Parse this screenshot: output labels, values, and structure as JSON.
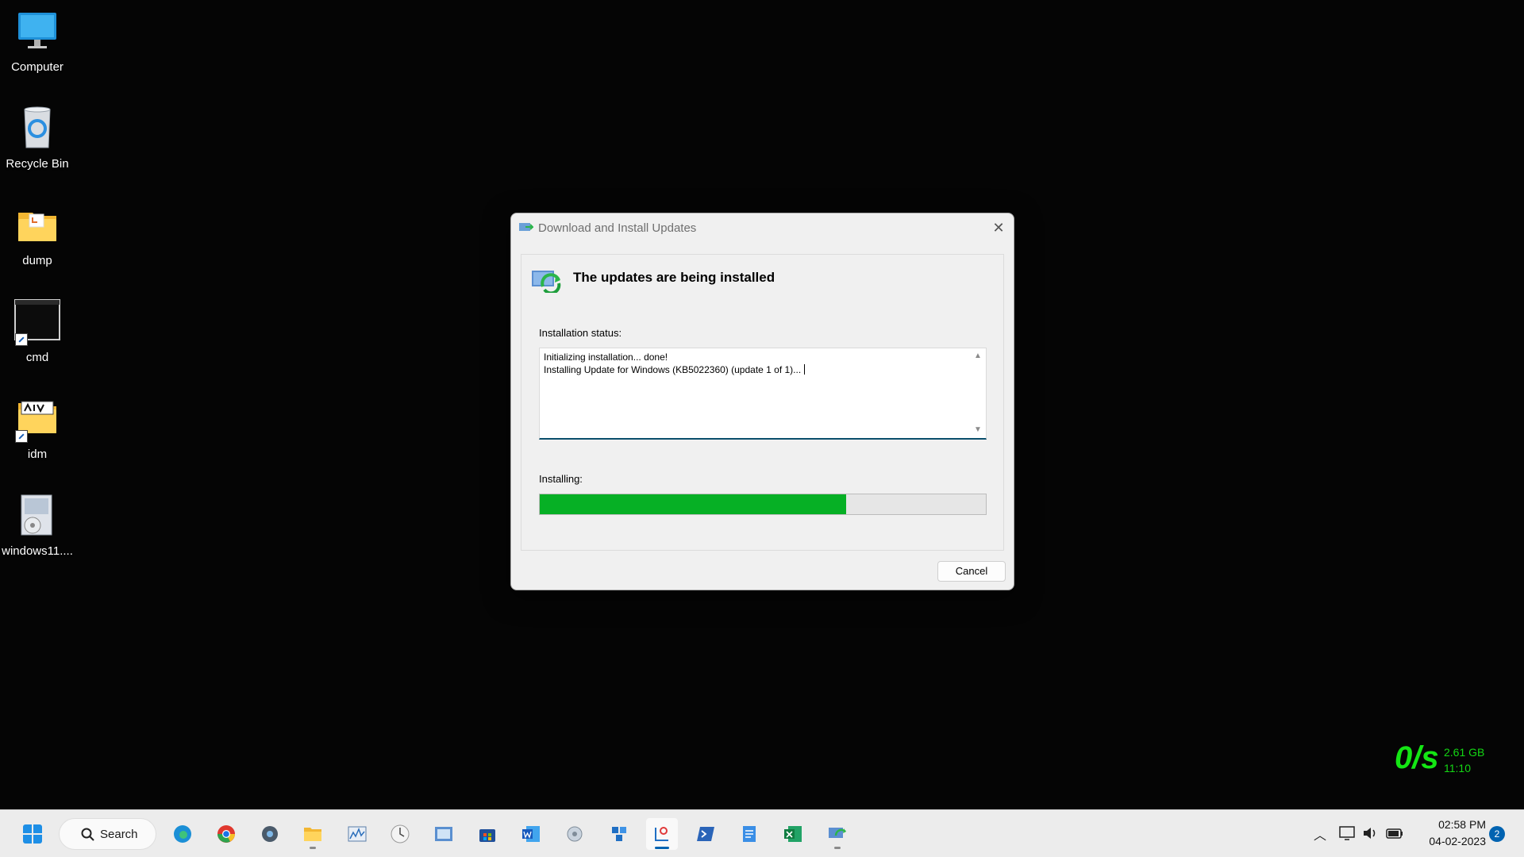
{
  "desktop": {
    "icons": [
      {
        "label": "Computer",
        "icon": "monitor-icon"
      },
      {
        "label": "Recycle Bin",
        "icon": "recycle-bin-icon"
      },
      {
        "label": "dump",
        "icon": "folder-icon"
      },
      {
        "label": "cmd",
        "icon": "terminal-icon"
      },
      {
        "label": "idm",
        "icon": "folder-icon"
      },
      {
        "label": "windows11....",
        "icon": "installer-icon"
      }
    ]
  },
  "dialog": {
    "title": "Download and Install Updates",
    "close_glyph": "✕",
    "heading": "The updates are being installed",
    "status_label": "Installation status:",
    "log_lines": [
      "Initializing installation... done!",
      "Installing Update for Windows (KB5022360) (update 1 of 1)..."
    ],
    "progress_label": "Installing:",
    "progress_fraction": 0.687,
    "cancel_label": "Cancel",
    "accent_color": "#06b025"
  },
  "netmeter": {
    "speed": "0/s",
    "data_used": "2.61 GB",
    "time": "11:10"
  },
  "taskbar": {
    "search_label": "Search",
    "apps": [
      "edge-icon",
      "chrome-icon",
      "settings-icon",
      "file-explorer-icon",
      "performance-monitor-icon",
      "clock-icon",
      "control-panel-icon",
      "store-icon",
      "word-icon",
      "system-config-icon",
      "dev-tools-icon",
      "snipping-tool-icon",
      "powershell-icon",
      "notepad-icon",
      "excel-icon",
      "windows-update-icon"
    ],
    "tray": {
      "time": "02:58 PM",
      "date": "04-02-2023",
      "notifications": "2"
    }
  }
}
